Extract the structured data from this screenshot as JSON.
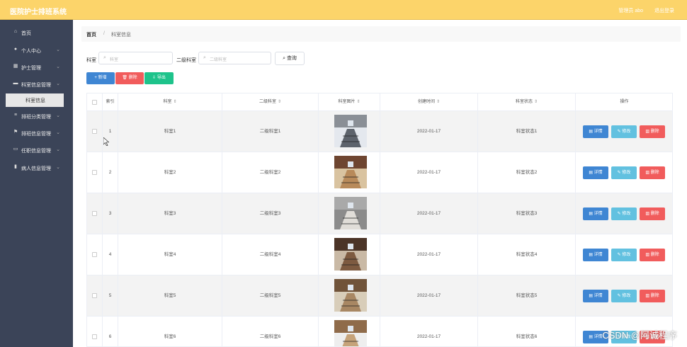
{
  "header": {
    "title": "医院护士排班系统",
    "user_label": "管理员 abo",
    "logout_label": "退出登录"
  },
  "sidebar": {
    "items": [
      {
        "label": "首页",
        "icon": "home-icon",
        "glyph": "⌂",
        "has_arrow": false
      },
      {
        "label": "个人中心",
        "icon": "user-icon",
        "glyph": "●",
        "has_arrow": true
      },
      {
        "label": "护士管理",
        "icon": "grid-icon",
        "glyph": "▦",
        "has_arrow": true
      },
      {
        "label": "科室信息管理",
        "icon": "chat-icon",
        "glyph": "▬",
        "has_arrow": true
      },
      {
        "label": "排班分类管理",
        "icon": "menu-icon",
        "glyph": "≡",
        "has_arrow": true
      },
      {
        "label": "排班信息管理",
        "icon": "flag-icon",
        "glyph": "⚑",
        "has_arrow": true
      },
      {
        "label": "任职信息管理",
        "icon": "monitor-icon",
        "glyph": "▭",
        "has_arrow": true
      },
      {
        "label": "病人信息管理",
        "icon": "chart-icon",
        "glyph": "▮",
        "has_arrow": true
      }
    ],
    "active_sub": "科室信息",
    "arrow_glyph": "⌄"
  },
  "breadcrumb": {
    "home": "首页",
    "sep": "/",
    "current": "科室信息"
  },
  "filters": {
    "dept_label": "科室",
    "dept_placeholder": "科室",
    "subdept_label": "二级科室",
    "subdept_placeholder": "二级科室",
    "query_label": "查询",
    "search_glyph": "⌕"
  },
  "actions": {
    "add": "+ 新增",
    "delete": "🗑 删除",
    "export": "⇩ 导出"
  },
  "table": {
    "headers": [
      "索引",
      "科室",
      "二级科室",
      "科室图片",
      "创建时间",
      "科室状态",
      "操作"
    ],
    "sort_glyph": "⇕",
    "rows": [
      {
        "index": "1",
        "dept": "科室1",
        "subdept": "二级科室1",
        "created": "2022-01-17",
        "status": "科室状态1"
      },
      {
        "index": "2",
        "dept": "科室2",
        "subdept": "二级科室2",
        "created": "2022-01-17",
        "status": "科室状态2"
      },
      {
        "index": "3",
        "dept": "科室3",
        "subdept": "二级科室3",
        "created": "2022-01-17",
        "status": "科室状态3"
      },
      {
        "index": "4",
        "dept": "科室4",
        "subdept": "二级科室4",
        "created": "2022-01-17",
        "status": "科室状态4"
      },
      {
        "index": "5",
        "dept": "科室5",
        "subdept": "二级科室5",
        "created": "2022-01-17",
        "status": "科室状态5"
      },
      {
        "index": "6",
        "dept": "科室6",
        "subdept": "二级科室6",
        "created": "2022-01-17",
        "status": "科室状态6"
      }
    ],
    "row_buttons": {
      "detail": "▤ 详情",
      "edit": "✎ 修改",
      "delete": "▥ 删除"
    }
  },
  "watermark": "CSDN @阿诚程序",
  "colors": {
    "topbar": "#fcd46a",
    "sidebar": "#3b4458",
    "primary": "#3f86d3",
    "danger": "#f15c5c",
    "success": "#1ec38b",
    "info": "#62c1e0"
  }
}
